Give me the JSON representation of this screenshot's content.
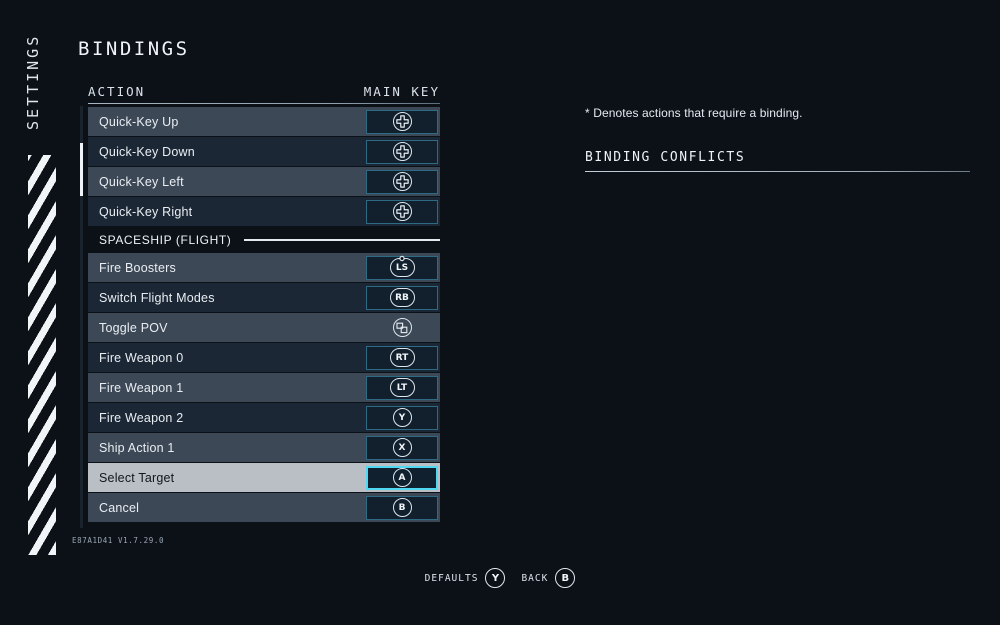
{
  "sidebar": {
    "vertical_label": "SETTINGS"
  },
  "header": {
    "title": "BINDINGS"
  },
  "columns": {
    "action": "ACTION",
    "main_key": "MAIN KEY"
  },
  "rows": [
    {
      "kind": "binding",
      "label": "Quick-Key Up",
      "key": "dpad",
      "key_style": "boxed",
      "selected": false
    },
    {
      "kind": "binding",
      "label": "Quick-Key Down",
      "key": "dpad",
      "key_style": "boxed",
      "selected": false
    },
    {
      "kind": "binding",
      "label": "Quick-Key Left",
      "key": "dpad",
      "key_style": "boxed",
      "selected": false
    },
    {
      "kind": "binding",
      "label": "Quick-Key Right",
      "key": "dpad",
      "key_style": "boxed",
      "selected": false
    },
    {
      "kind": "section",
      "label": "SPACESHIP (FLIGHT)"
    },
    {
      "kind": "binding",
      "label": "Fire Boosters",
      "key": "LS",
      "key_style": "boxed",
      "selected": false
    },
    {
      "kind": "binding",
      "label": "Switch Flight Modes",
      "key": "RB",
      "key_style": "boxed",
      "selected": false
    },
    {
      "kind": "binding",
      "label": "Toggle POV",
      "key": "window",
      "key_style": "plain",
      "selected": false
    },
    {
      "kind": "binding",
      "label": "Fire Weapon 0",
      "key": "RT",
      "key_style": "boxed",
      "selected": false
    },
    {
      "kind": "binding",
      "label": "Fire Weapon 1",
      "key": "LT",
      "key_style": "boxed",
      "selected": false
    },
    {
      "kind": "binding",
      "label": "Fire Weapon 2",
      "key": "Y",
      "key_style": "boxed",
      "selected": false
    },
    {
      "kind": "binding",
      "label": "Ship Action 1",
      "key": "X",
      "key_style": "boxed",
      "selected": false
    },
    {
      "kind": "binding",
      "label": "Select Target",
      "key": "A",
      "key_style": "boxed",
      "selected": true
    },
    {
      "kind": "binding",
      "label": "Cancel",
      "key": "B",
      "key_style": "boxed",
      "selected": false
    }
  ],
  "info_panel": {
    "note": "* Denotes actions that require a binding.",
    "conflicts_heading": "BINDING CONFLICTS"
  },
  "version": "E87A1D41 V1.7.29.0",
  "footer": {
    "buttons": [
      {
        "label": "DEFAULTS",
        "glyph": "Y"
      },
      {
        "label": "BACK",
        "glyph": "B"
      }
    ]
  },
  "colors": {
    "background": "#0c1118",
    "row_light": "#3c4856",
    "row_dark": "#1b2735",
    "row_selected": "#b9bfc4",
    "key_border": "#2d6b84",
    "key_border_selected": "#4fd8ef",
    "key_fill": "#12202e",
    "text": "#e8edf2"
  }
}
